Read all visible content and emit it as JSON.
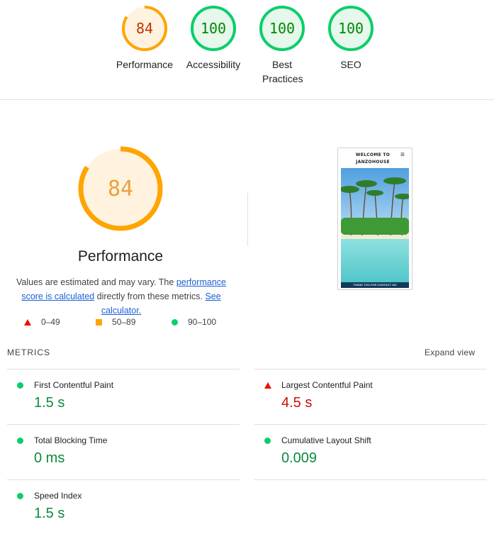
{
  "summary_gauges": [
    {
      "label": "Performance",
      "score": "84",
      "status": "average"
    },
    {
      "label": "Accessibility",
      "score": "100",
      "status": "pass"
    },
    {
      "label": "Best Practices",
      "score": "100",
      "status": "pass"
    },
    {
      "label": "SEO",
      "score": "100",
      "status": "pass"
    }
  ],
  "performance": {
    "score": "84",
    "title": "Performance",
    "desc_prefix": "Values are estimated and may vary. The ",
    "desc_link1": "performance score is calculated",
    "desc_middle": " directly from these metrics. ",
    "desc_link2": "See calculator."
  },
  "legend": [
    {
      "range": "0–49",
      "icon": "red-triangle"
    },
    {
      "range": "50–89",
      "icon": "orange-square"
    },
    {
      "range": "90–100",
      "icon": "green-circle"
    }
  ],
  "screenshot": {
    "title": "WELCOME TO JANZOHOUSE",
    "menu_icon": "≡",
    "footer_text": "THANK YOU FOR CONTACT US!"
  },
  "metrics": {
    "title": "METRICS",
    "expand_label": "Expand view",
    "items": [
      {
        "name": "First Contentful Paint",
        "value": "1.5 s",
        "status": "pass"
      },
      {
        "name": "Largest Contentful Paint",
        "value": "4.5 s",
        "status": "fail"
      },
      {
        "name": "Total Blocking Time",
        "value": "0 ms",
        "status": "pass"
      },
      {
        "name": "Cumulative Layout Shift",
        "value": "0.009",
        "status": "pass"
      },
      {
        "name": "Speed Index",
        "value": "1.5 s",
        "status": "pass"
      }
    ]
  },
  "colors": {
    "pass": "#0cce6b",
    "average": "#ffa400",
    "fail": "#ff4e42",
    "pass_text": "#008800",
    "average_text": "#c33300",
    "link": "#1a5fd6"
  }
}
